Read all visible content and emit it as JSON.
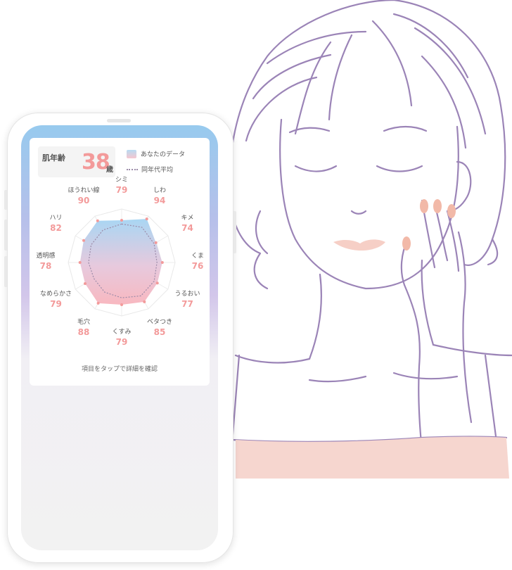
{
  "skin_panel": {
    "age_label": "肌年齢",
    "age_value": "38",
    "age_unit": "歳",
    "legend_you": "あなたのデータ",
    "legend_avg": "同年代平均",
    "hint": "項目をタップで詳細を確認"
  },
  "colors": {
    "accent": "#f39a9a",
    "illustration_line": "#9b84b7",
    "skin": "#f6d6cf"
  },
  "chart_data": {
    "type": "radar",
    "title": "",
    "axes": [
      "シミ",
      "しわ",
      "キメ",
      "くま",
      "うるおい",
      "ベタつき",
      "くすみ",
      "毛穴",
      "なめらかさ",
      "透明感",
      "ハリ",
      "ほうれい線"
    ],
    "series": [
      {
        "name": "あなたのデータ",
        "values": [
          79,
          94,
          74,
          76,
          77,
          85,
          79,
          88,
          79,
          78,
          82,
          90
        ]
      },
      {
        "name": "同年代平均",
        "values": [
          72,
          76,
          70,
          66,
          70,
          72,
          66,
          64,
          60,
          62,
          66,
          70
        ]
      }
    ],
    "range": [
      0,
      100
    ],
    "legend": "top-right"
  }
}
